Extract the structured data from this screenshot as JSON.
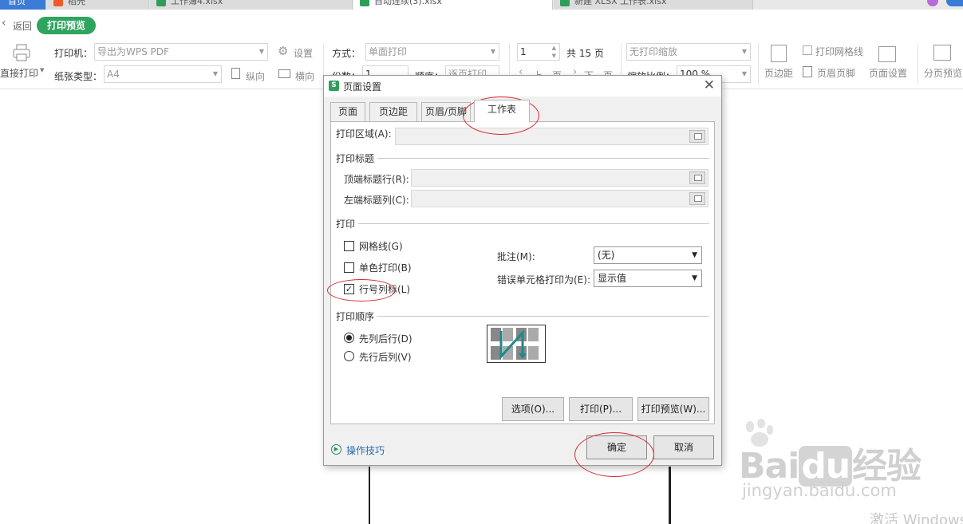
{
  "tabs": [
    {
      "label": "首页"
    },
    {
      "label": "稻壳"
    },
    {
      "label": "工作簿4.xlsx"
    },
    {
      "label": "自动连续(3).xlsx"
    },
    {
      "label": "新建 XLSX 工作表.xlsx"
    }
  ],
  "preview_bar": {
    "back": "返回",
    "title": "打印预览"
  },
  "toolbar": {
    "direct_print": "直接打印",
    "printer_label": "打印机：",
    "printer_value": "导出为WPS PDF",
    "settings": "设置",
    "paper_label": "纸张类型：",
    "paper_value": "A4",
    "portrait": "纵向",
    "landscape": "横向",
    "mode_label": "方式：",
    "mode_value": "单面打印",
    "copies_label": "份数：",
    "copies_value": "1",
    "order_label": "顺序：",
    "order_value": "逐页打印",
    "page_value": "1",
    "total_pages": "共 15 页",
    "prev_page": "上一页",
    "next_page": "下一页",
    "scale_value": "无打印缩放",
    "zoom_label": "缩放比例：",
    "zoom_value": "100 %",
    "gridlines": "打印网格线",
    "margins": "页边距",
    "header_footer": "页眉页脚",
    "page_setup": "页面设置",
    "page_break": "分页预览"
  },
  "dialog": {
    "title": "页面设置",
    "tabs": [
      "页面",
      "页边距",
      "页眉/页脚",
      "工作表"
    ],
    "print_area_label": "打印区域(A):",
    "print_titles_heading": "打印标题",
    "top_rows_label": "顶端标题行(R):",
    "left_cols_label": "左端标题列(C):",
    "print_heading": "打印",
    "gridlines_label": "网格线(G)",
    "gridlines_checked": false,
    "mono_label": "单色打印(B)",
    "mono_checked": false,
    "rowcol_label": "行号列标(L)",
    "rowcol_checked": true,
    "comments_label": "批注(M):",
    "comments_value": "(无)",
    "errors_label": "错误单元格打印为(E):",
    "errors_value": "显示值",
    "order_heading": "打印顺序",
    "order_down_then_over": "先列后行(D)",
    "order_over_then_down": "先行后列(V)",
    "order_selected": "down_then_over",
    "options_button": "选项(O)...",
    "print_button": "打印(P)...",
    "preview_button": "打印预览(W)...",
    "tips": "操作技巧",
    "ok": "确定",
    "cancel": "取消"
  },
  "watermark": {
    "brand": "Bai",
    "brand2": "du",
    "brand3": "经验",
    "url": "jingyan.baidu.com",
    "activate": "激活 Windows"
  },
  "colors": {
    "accent_green": "#2fa45f",
    "annotation_red": "#d8282c",
    "wps_green": "#2f9e5b"
  }
}
